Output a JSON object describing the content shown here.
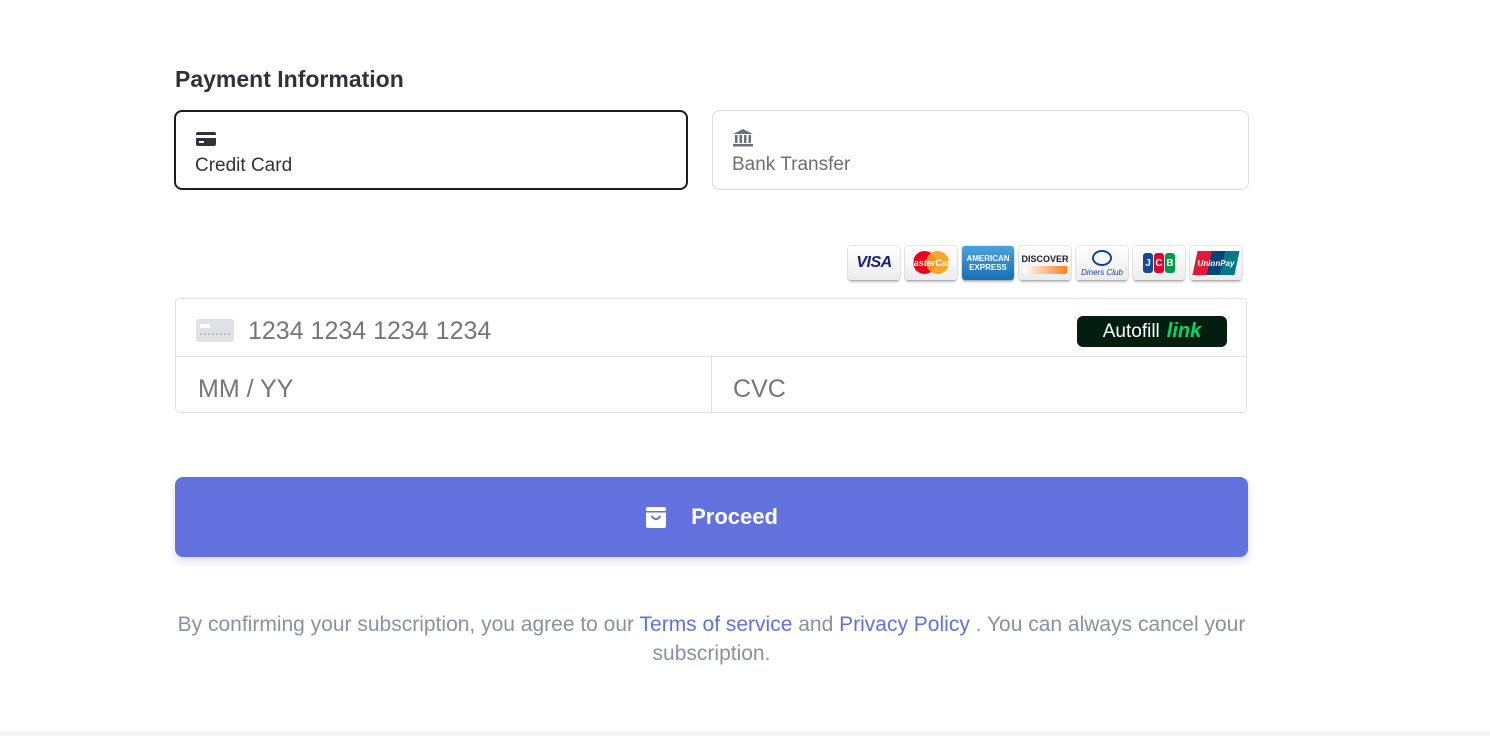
{
  "payment": {
    "heading": "Payment Information",
    "methods": [
      {
        "label": "Credit Card",
        "icon": "credit-card-icon",
        "selected": true
      },
      {
        "label": "Bank Transfer",
        "icon": "bank-icon",
        "selected": false
      }
    ]
  },
  "brands": [
    {
      "name": "visa",
      "label": "VISA"
    },
    {
      "name": "mastercard",
      "label": "MasterCard"
    },
    {
      "name": "amex",
      "label": "AMERICAN EXPRESS"
    },
    {
      "name": "discover",
      "label": "DISCOVER"
    },
    {
      "name": "diners",
      "label": "Diners Club"
    },
    {
      "name": "jcb",
      "label": "JCB"
    },
    {
      "name": "unionpay",
      "label": "UnionPay"
    }
  ],
  "card": {
    "number_placeholder": "1234 1234 1234 1234",
    "expiry_placeholder": "MM / YY",
    "cvc_placeholder": "CVC",
    "autofill_text": "Autofill",
    "autofill_link": "link"
  },
  "proceed": {
    "label": "Proceed"
  },
  "legal": {
    "prefix": "By confirming your subscription, you agree to our",
    "terms": "Terms of service",
    "and": "and",
    "privacy": "Privacy Policy",
    "suffix": ". You can always cancel your subscription."
  },
  "colors": {
    "accent": "#6371df",
    "link_green": "#00d66f",
    "autofill_bg": "#011e0f",
    "muted_text": "#8792a2"
  }
}
